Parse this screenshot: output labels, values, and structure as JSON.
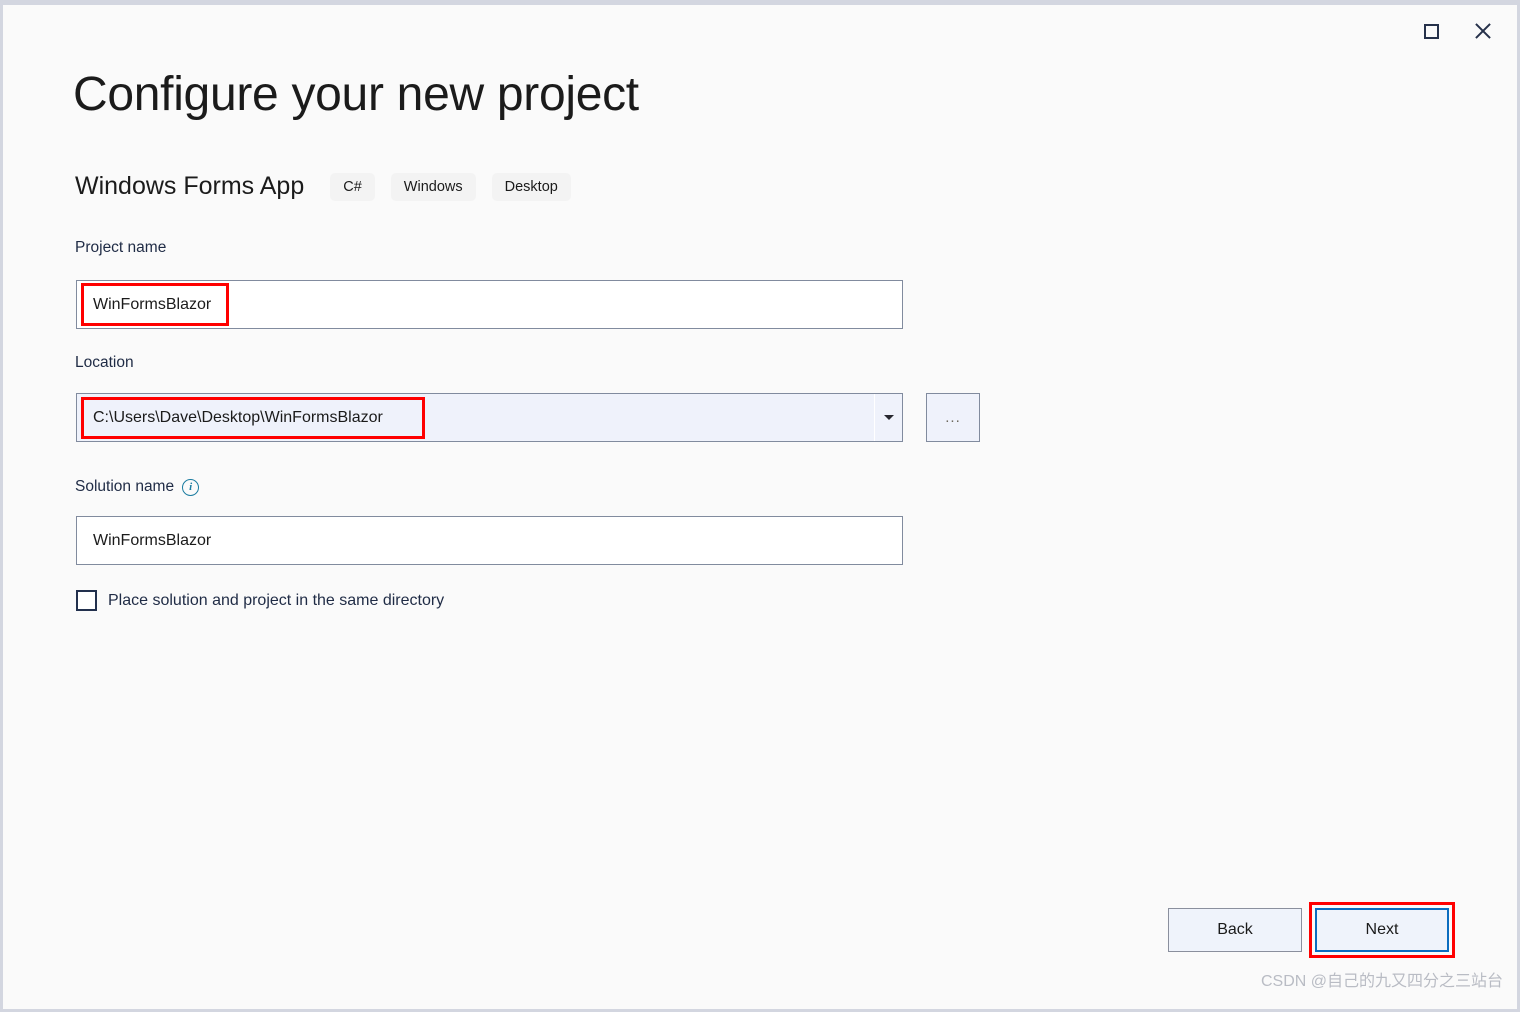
{
  "window": {
    "maximize_icon": "maximize-icon",
    "close_icon": "close-icon"
  },
  "header": {
    "title": "Configure your new project",
    "template_name": "Windows Forms App",
    "tags": [
      "C#",
      "Windows",
      "Desktop"
    ]
  },
  "form": {
    "project_name": {
      "label": "Project name",
      "value": "WinFormsBlazor"
    },
    "location": {
      "label": "Location",
      "value": "C:\\Users\\Dave\\Desktop\\WinFormsBlazor",
      "dropdown_icon": "chevron-down-icon",
      "browse_label": "..."
    },
    "solution_name": {
      "label": "Solution name",
      "info_icon": "info-icon",
      "info_glyph": "i",
      "value": "WinFormsBlazor"
    },
    "same_directory_checkbox": {
      "label": "Place solution and project in the same directory",
      "checked": false
    }
  },
  "footer": {
    "back_label": "Back",
    "next_label": "Next"
  },
  "watermark": {
    "text": "CSDN @自己的九又四分之三站台"
  },
  "colors": {
    "accent_blue": "#0b6cbf",
    "annotation_red": "#ff0000",
    "info_teal": "#1b7ca0",
    "dialog_bg": "#fafafa",
    "field_border": "#818b9e"
  }
}
